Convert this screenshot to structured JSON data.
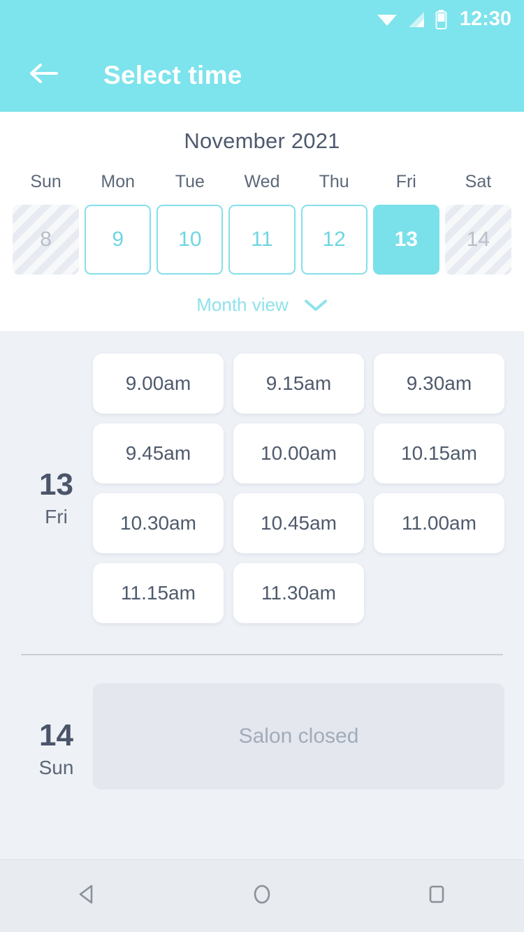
{
  "status_bar": {
    "time": "12:30",
    "icons": [
      "wifi-icon",
      "signal-icon",
      "battery-icon"
    ]
  },
  "app_bar": {
    "back_icon": "back-arrow-icon",
    "title": "Select time"
  },
  "calendar": {
    "month_label": "November 2021",
    "weekdays": [
      "Sun",
      "Mon",
      "Tue",
      "Wed",
      "Thu",
      "Fri",
      "Sat"
    ],
    "days": [
      {
        "number": "8",
        "state": "disabled"
      },
      {
        "number": "9",
        "state": "available"
      },
      {
        "number": "10",
        "state": "available"
      },
      {
        "number": "11",
        "state": "available"
      },
      {
        "number": "12",
        "state": "available"
      },
      {
        "number": "13",
        "state": "selected"
      },
      {
        "number": "14",
        "state": "disabled"
      }
    ],
    "month_view_label": "Month view",
    "month_view_icon": "chevron-down-icon"
  },
  "schedule": [
    {
      "day_number": "13",
      "day_name": "Fri",
      "slots": [
        "9.00am",
        "9.15am",
        "9.30am",
        "9.45am",
        "10.00am",
        "10.15am",
        "10.30am",
        "10.45am",
        "11.00am",
        "11.15am",
        "11.30am"
      ]
    },
    {
      "day_number": "14",
      "day_name": "Sun",
      "closed_message": "Salon closed"
    }
  ],
  "nav_bar": {
    "back": "nav-back-icon",
    "home": "nav-home-icon",
    "recents": "nav-recents-icon"
  },
  "colors": {
    "accent": "#7de3ec",
    "accent_border": "#84dfe9",
    "page_bg": "#eef1f6",
    "text_dark": "#4a5569",
    "text_muted": "#a2abba"
  }
}
